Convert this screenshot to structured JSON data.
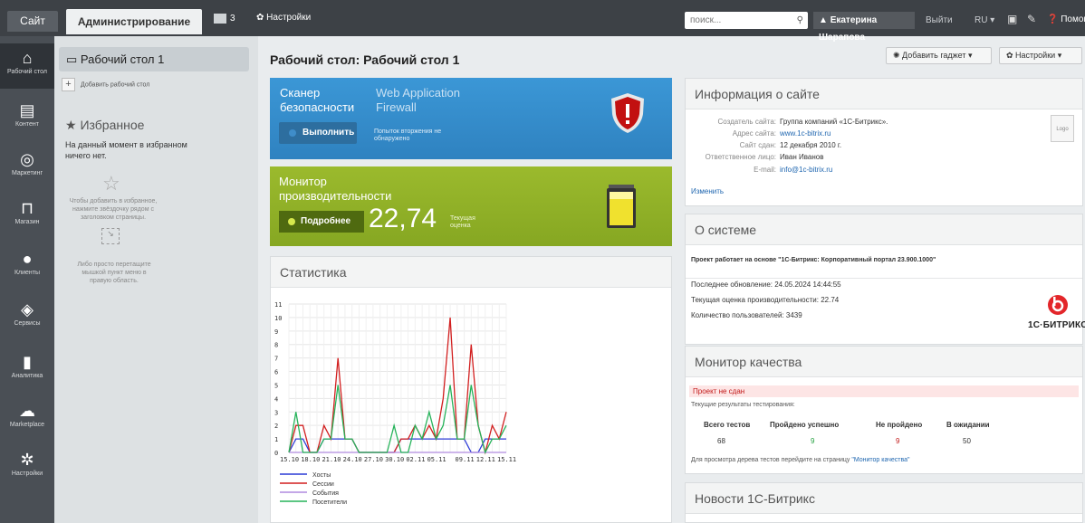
{
  "topbar": {
    "site_tab": "Сайт",
    "admin_tab": "Администрирование",
    "notif_count": "3",
    "settings": "Настройки",
    "search_placeholder": "поиск...",
    "user": "Екатерина Шарапова",
    "logout": "Выйти",
    "lang": "RU",
    "help": "Помощь"
  },
  "leftnav": [
    {
      "label": "Рабочий стол",
      "icon": "home-icon"
    },
    {
      "label": "Контент",
      "icon": "document-icon"
    },
    {
      "label": "Маркетинг",
      "icon": "target-icon"
    },
    {
      "label": "Магазин",
      "icon": "cart-icon"
    },
    {
      "label": "Клиенты",
      "icon": "clients-icon"
    },
    {
      "label": "Сервисы",
      "icon": "layers-icon"
    },
    {
      "label": "Аналитика",
      "icon": "analytics-icon"
    },
    {
      "label": "Marketplace",
      "icon": "cloud-icon"
    },
    {
      "label": "Настройки",
      "icon": "gear-icon"
    }
  ],
  "panel": {
    "desktop": "Рабочий стол 1",
    "add_desktop": "Добавить рабочий стол",
    "favorites_title": "Избранное",
    "favorites_empty": "На данный момент в избранном ничего нет.",
    "hint_star": "Чтобы добавить в избранное, нажмите звёздочку рядом с заголовком страницы.",
    "hint_drag": "Либо просто перетащите мышкой пункт меню в правую область."
  },
  "page": {
    "title": "Рабочий стол: Рабочий стол 1",
    "add_gadget": "Добавить гаджет",
    "settings": "Настройки"
  },
  "scanner": {
    "title": "Сканер безопасности",
    "subtitle": "Web Application Firewall",
    "button": "Выполнить",
    "note": "Попыток вторжения не обнаружено"
  },
  "perf": {
    "title": "Монитор производительности",
    "button": "Подробнее",
    "value": "22,74",
    "label": "Текущая оценка"
  },
  "stats": {
    "title": "Статистика"
  },
  "chart_data": {
    "type": "line",
    "title": "",
    "x": [
      "15.10",
      "16.10",
      "17.10",
      "18.10",
      "19.10",
      "20.10",
      "21.10",
      "22.10",
      "23.10",
      "24.10",
      "25.10",
      "26.10",
      "27.10",
      "28.10",
      "29.10",
      "30.10",
      "31.10",
      "01.11",
      "02.11",
      "03.11",
      "04.11",
      "05.11",
      "06.11",
      "07.11",
      "08.11",
      "09.11",
      "10.11",
      "11.11",
      "12.11",
      "13.11",
      "14.11",
      "15.11"
    ],
    "xticks": [
      "15.10",
      "18.10",
      "21.10",
      "24.10",
      "27.10",
      "30.10",
      "02.11",
      "05.11",
      "09.11",
      "12.11",
      "15.11"
    ],
    "ylim": [
      0,
      11
    ],
    "yticks": [
      0,
      1,
      2,
      3,
      4,
      5,
      6,
      7,
      8,
      9,
      10,
      11
    ],
    "series": [
      {
        "name": "Хосты",
        "color": "#2c3bd6",
        "values": [
          0,
          1,
          1,
          0,
          0,
          1,
          1,
          1,
          1,
          1,
          0,
          0,
          0,
          0,
          0,
          0,
          1,
          1,
          1,
          1,
          1,
          1,
          1,
          1,
          1,
          1,
          0,
          0,
          1,
          1,
          1,
          1
        ]
      },
      {
        "name": "Сессии",
        "color": "#d21f1f",
        "values": [
          0,
          2,
          2,
          0,
          0,
          2,
          1,
          7,
          1,
          1,
          0,
          0,
          0,
          0,
          0,
          0,
          1,
          1,
          2,
          1,
          2,
          1,
          4,
          10,
          1,
          1,
          8,
          2,
          0,
          2,
          1,
          3
        ]
      },
      {
        "name": "События",
        "color": "#b08adf",
        "values": [
          0,
          0,
          0,
          0,
          0,
          0,
          0,
          0,
          0,
          0,
          0,
          0,
          0,
          0,
          0,
          0,
          0,
          0,
          0,
          0,
          0,
          0,
          0,
          0,
          0,
          0,
          0,
          0,
          0,
          0,
          0,
          0
        ]
      },
      {
        "name": "Посетители",
        "color": "#26b35a",
        "values": [
          0,
          3,
          0,
          0,
          0,
          1,
          1,
          5,
          1,
          1,
          0,
          0,
          0,
          0,
          0,
          2,
          0,
          0,
          2,
          1,
          3,
          1,
          2,
          5,
          1,
          1,
          5,
          2,
          0,
          1,
          1,
          2
        ]
      }
    ]
  },
  "siteinfo": {
    "title": "Информация о сайте",
    "rows": [
      {
        "k": "Создатель сайта:",
        "v": "Группа компаний «1С-Битрикс»."
      },
      {
        "k": "Адрес сайта:",
        "v": "www.1c-bitrix.ru"
      },
      {
        "k": "Сайт сдан:",
        "v": "12 декабря 2010 г."
      },
      {
        "k": "Ответственное лицо:",
        "v": "Иван Иванов"
      },
      {
        "k": "E-mail:",
        "v": "info@1c-bitrix.ru"
      }
    ],
    "logo": "Logo",
    "edit": "Изменить"
  },
  "system": {
    "title": "О системе",
    "project": "Проект работает на основе \"1С-Битрикс: Корпоративный портал 23.900.1000\"",
    "updated": "Последнее обновление: 24.05.2024 14:44:55",
    "score": "Текущая оценка производительности: 22.74",
    "users": "Количество пользователей: 3439",
    "brand": "1С·БИТРИКС"
  },
  "quality": {
    "title": "Монитор качества",
    "status": "Проект не сдан",
    "sub": "Текущие результаты тестирования:",
    "headers": [
      "Всего тестов",
      "Пройдено успешно",
      "Не пройдено",
      "В ожидании"
    ],
    "values": [
      "68",
      "9",
      "9",
      "50"
    ],
    "foot": "Для просмотра дерева тестов перейдите на страницу ",
    "foot_link": "\"Монитор качества\""
  },
  "news": {
    "title": "Новости 1С-Битрикс"
  },
  "colors": {
    "accent_blue": "#2f86c6",
    "perf_green": "#8fb026",
    "danger": "#c21a1a"
  }
}
